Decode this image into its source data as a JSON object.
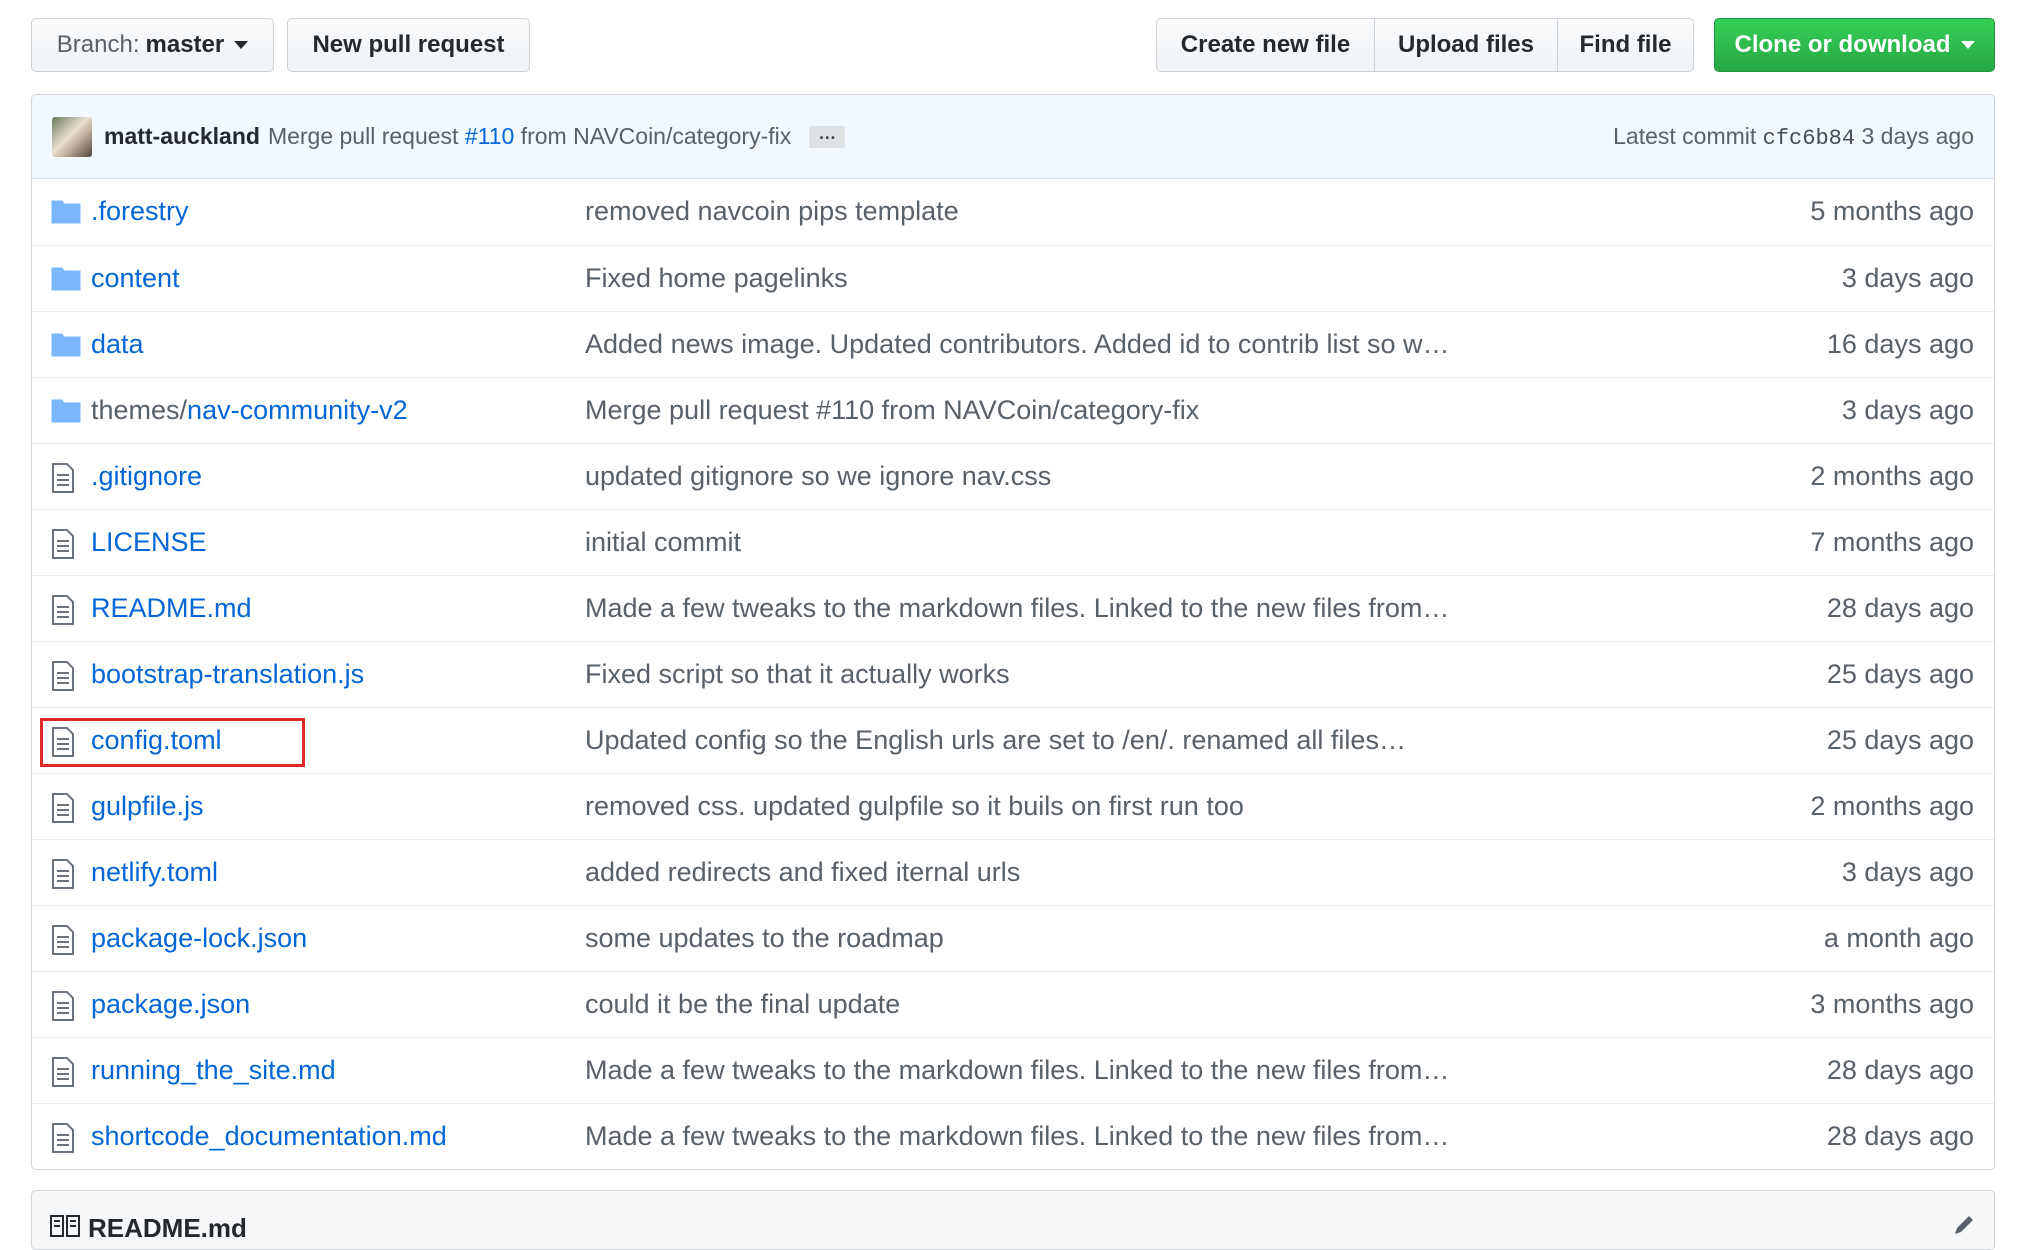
{
  "toolbar": {
    "branch_label": "Branch:",
    "branch_value": "master",
    "new_pr": "New pull request",
    "create_file": "Create new file",
    "upload_files": "Upload files",
    "find_file": "Find file",
    "clone_download": "Clone or download"
  },
  "commit": {
    "author": "matt-auckland",
    "message_prefix": "Merge pull request",
    "pr_link": "#110",
    "message_suffix": "from NAVCoin/category-fix",
    "ellipsis": "…",
    "latest_label": "Latest commit",
    "sha": "cfc6b84",
    "age": "3 days ago"
  },
  "files": [
    {
      "type": "folder",
      "prefix": "",
      "name": ".forestry",
      "message": "removed navcoin pips template",
      "age": "5 months ago"
    },
    {
      "type": "folder",
      "prefix": "",
      "name": "content",
      "message": "Fixed home pagelinks",
      "age": "3 days ago"
    },
    {
      "type": "folder",
      "prefix": "",
      "name": "data",
      "message": "Added news image. Updated contributors. Added id to contrib list so w…",
      "age": "16 days ago"
    },
    {
      "type": "folder",
      "prefix": "themes/",
      "name": "nav-community-v2",
      "message": "Merge pull request #110 from NAVCoin/category-fix",
      "age": "3 days ago"
    },
    {
      "type": "file",
      "prefix": "",
      "name": ".gitignore",
      "message": "updated gitignore so we ignore nav.css",
      "age": "2 months ago"
    },
    {
      "type": "file",
      "prefix": "",
      "name": "LICENSE",
      "message": "initial commit",
      "age": "7 months ago"
    },
    {
      "type": "file",
      "prefix": "",
      "name": "README.md",
      "message": "Made a few tweaks to the markdown files. Linked to the new files from…",
      "age": "28 days ago"
    },
    {
      "type": "file",
      "prefix": "",
      "name": "bootstrap-translation.js",
      "message": "Fixed script so that it actually works",
      "age": "25 days ago"
    },
    {
      "type": "file",
      "prefix": "",
      "name": "config.toml",
      "message": "Updated config so the English urls are set to /en/. renamed all files…",
      "age": "25 days ago"
    },
    {
      "type": "file",
      "prefix": "",
      "name": "gulpfile.js",
      "message": "removed css. updated gulpfile so it buils on first run too",
      "age": "2 months ago"
    },
    {
      "type": "file",
      "prefix": "",
      "name": "netlify.toml",
      "message": "added redirects and fixed iternal urls",
      "age": "3 days ago"
    },
    {
      "type": "file",
      "prefix": "",
      "name": "package-lock.json",
      "message": "some updates to the roadmap",
      "age": "a month ago"
    },
    {
      "type": "file",
      "prefix": "",
      "name": "package.json",
      "message": "could it be the final update",
      "age": "3 months ago"
    },
    {
      "type": "file",
      "prefix": "",
      "name": "running_the_site.md",
      "message": "Made a few tweaks to the markdown files. Linked to the new files from…",
      "age": "28 days ago"
    },
    {
      "type": "file",
      "prefix": "",
      "name": "shortcode_documentation.md",
      "message": "Made a few tweaks to the markdown files. Linked to the new files from…",
      "age": "28 days ago"
    }
  ],
  "readme": {
    "title": "README.md"
  },
  "colors": {
    "link": "#0366d6",
    "green": "#28a745",
    "highlight": "#e0292b"
  }
}
